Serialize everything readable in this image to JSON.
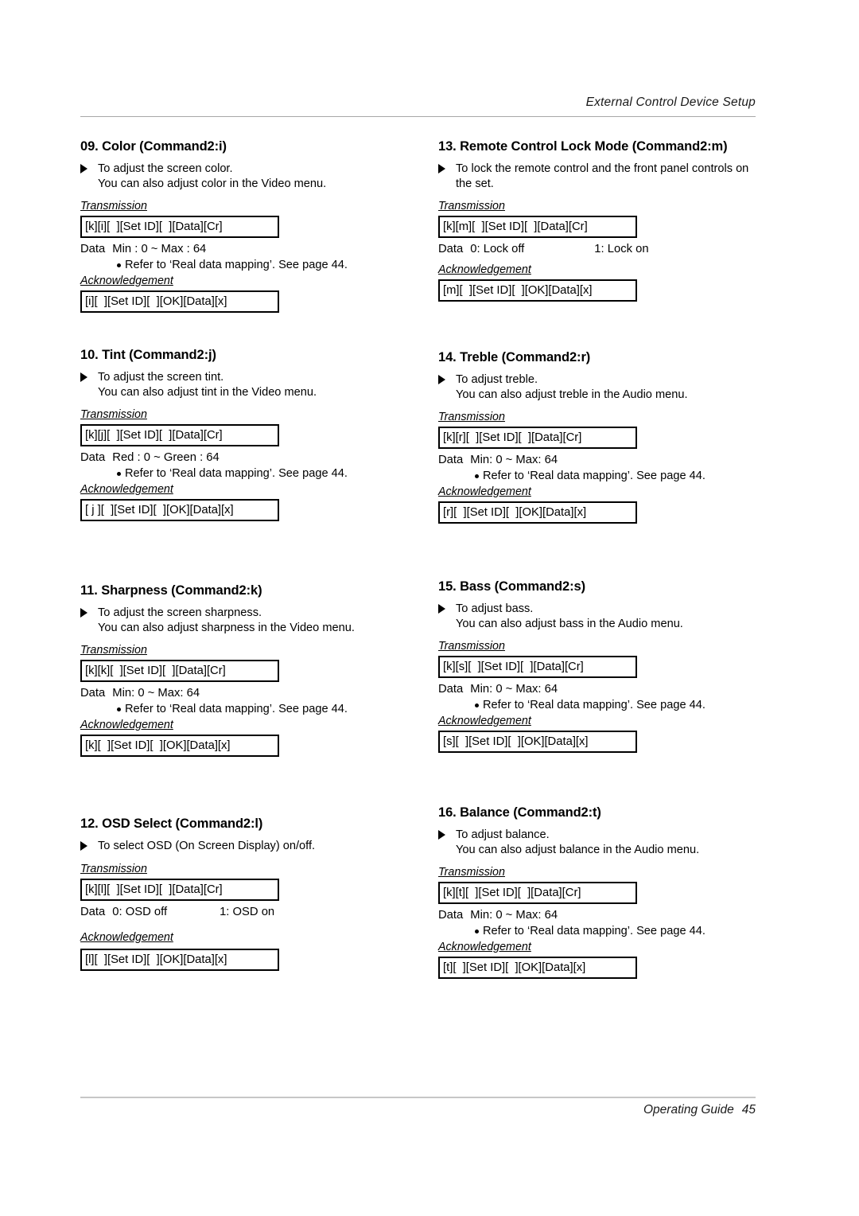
{
  "header": {
    "title": "External Control Device Setup"
  },
  "footer": {
    "guide": "Operating Guide",
    "page": "45"
  },
  "labels": {
    "transmission": "Transmission",
    "acknowledgement": "Acknowledgement",
    "data": "Data",
    "refer": "Refer to ‘Real data mapping’. See page 44."
  },
  "sections": {
    "s09": {
      "title": "09. Color (Command2:i)",
      "desc_line1": "To adjust the screen color.",
      "desc_line2": "You can also adjust color in the Video menu.",
      "transmission": "[k][i][  ][Set ID][  ][Data][Cr]",
      "data_label": "Data",
      "data_value": "Min : 0 ~ Max : 64",
      "refer": "Refer to ‘Real data mapping’. See page 44.",
      "acknowledgement": "[i][  ][Set ID][  ][OK][Data][x]"
    },
    "s10": {
      "title": "10. Tint (Command2:j)",
      "desc_line1": "To adjust the screen tint.",
      "desc_line2": "You can also adjust tint in the Video menu.",
      "transmission": "[k][j][  ][Set ID][  ][Data][Cr]",
      "data_label": "Data",
      "data_value": "Red : 0 ~ Green : 64",
      "refer": "Refer to ‘Real data mapping’. See page 44.",
      "acknowledgement": "[ j ][  ][Set ID][  ][OK][Data][x]"
    },
    "s11": {
      "title": "11. Sharpness (Command2:k)",
      "desc_line1": "To adjust the screen sharpness.",
      "desc_line2": "You can also adjust sharpness in the Video menu.",
      "transmission": "[k][k][  ][Set ID][  ][Data][Cr]",
      "data_label": "Data",
      "data_value": "Min: 0 ~ Max: 64",
      "refer": "Refer to ‘Real data mapping’. See page 44.",
      "acknowledgement": "[k][  ][Set ID][  ][OK][Data][x]"
    },
    "s12": {
      "title": "12. OSD Select (Command2:l)",
      "desc_line1": "To select OSD (On Screen Display) on/off.",
      "desc_line2": "",
      "transmission": "[k][l][  ][Set ID][  ][Data][Cr]",
      "data_label": "Data",
      "data_value": "0: OSD off",
      "data_value2": "1: OSD on",
      "acknowledgement": "[l][  ][Set ID][  ][OK][Data][x]"
    },
    "s13": {
      "title": "13. Remote Control Lock Mode (Command2:m)",
      "desc_line1": "To lock the remote control and the front panel controls on",
      "desc_line2": "the set.",
      "transmission": "[k][m][  ][Set ID][  ][Data][Cr]",
      "data_label": "Data",
      "data_value": "0: Lock off",
      "data_value2": "1: Lock on",
      "acknowledgement": "[m][  ][Set ID][  ][OK][Data][x]"
    },
    "s14": {
      "title": "14. Treble (Command2:r)",
      "desc_line1": "To adjust treble.",
      "desc_line2": "You can also adjust treble in the Audio menu.",
      "transmission": "[k][r][  ][Set ID][  ][Data][Cr]",
      "data_label": "Data",
      "data_value": "Min: 0 ~ Max: 64",
      "refer": "Refer to ‘Real data mapping’. See page 44.",
      "acknowledgement": "[r][  ][Set ID][  ][OK][Data][x]"
    },
    "s15": {
      "title": "15. Bass (Command2:s)",
      "desc_line1": "To adjust bass.",
      "desc_line2": "You can also adjust bass in the Audio menu.",
      "transmission": "[k][s][  ][Set ID][  ][Data][Cr]",
      "data_label": "Data",
      "data_value": "Min: 0 ~ Max: 64",
      "refer": "Refer to ‘Real data mapping’. See page 44.",
      "acknowledgement": "[s][  ][Set ID][  ][OK][Data][x]"
    },
    "s16": {
      "title": "16. Balance (Command2:t)",
      "desc_line1": "To adjust balance.",
      "desc_line2": "You can also adjust balance in the Audio menu.",
      "transmission": "[k][t][  ][Set ID][  ][Data][Cr]",
      "data_label": "Data",
      "data_value": "Min: 0 ~ Max: 64",
      "refer": "Refer to ‘Real data mapping’. See page 44.",
      "acknowledgement": "[t][  ][Set ID][  ][OK][Data][x]"
    }
  }
}
